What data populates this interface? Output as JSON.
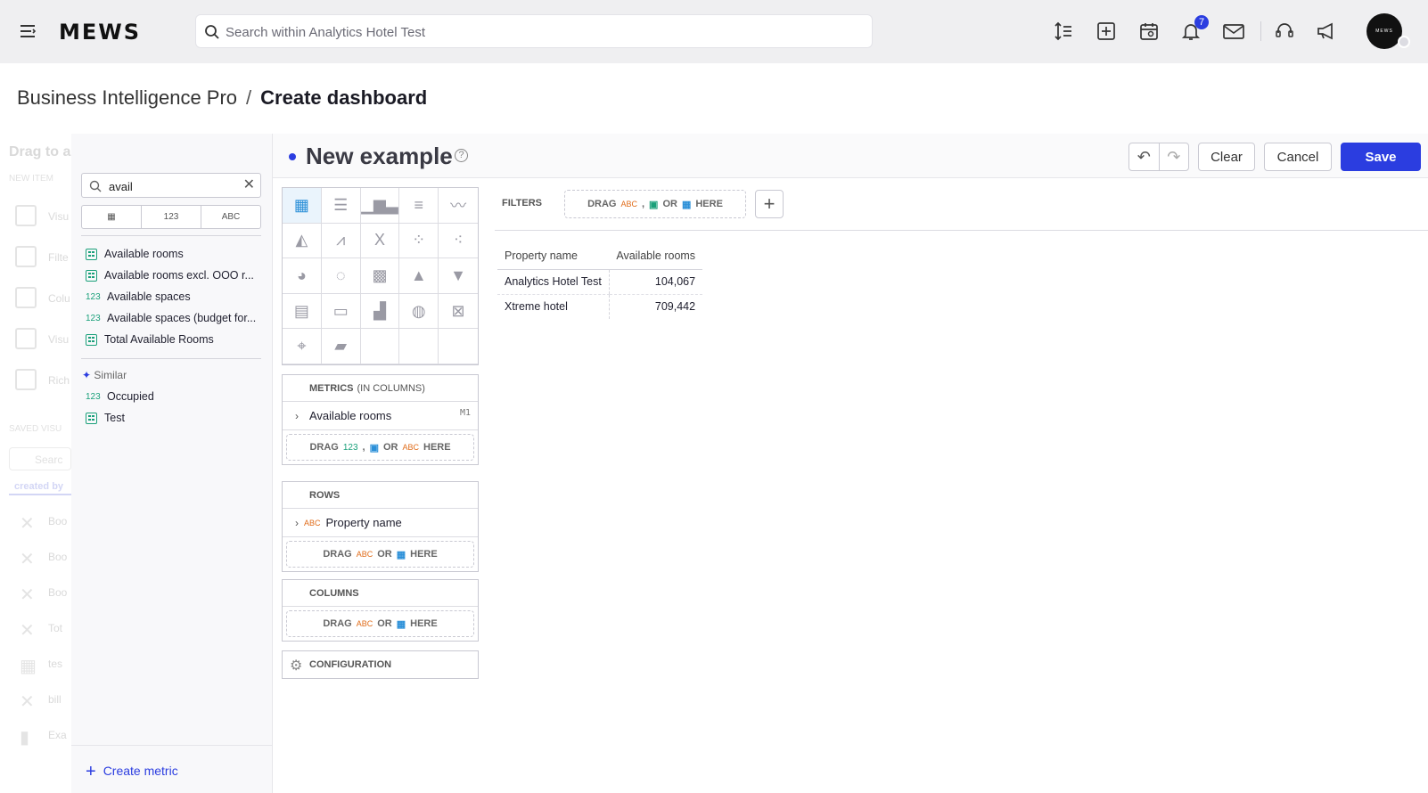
{
  "header": {
    "logo": "MEWS",
    "search_placeholder": "Search within Analytics Hotel Test",
    "notification_count": "7",
    "avatar_text": "MEWS"
  },
  "breadcrumb": {
    "parent": "Business Intelligence Pro",
    "separator": "/",
    "current": "Create dashboard"
  },
  "background_panel": {
    "title": "Drag to a",
    "new_item": "NEW ITEM",
    "items": [
      "Visu",
      "Filte",
      "Colu",
      "Visu",
      "Rich"
    ],
    "saved_label": "SAVED VISU",
    "search_placeholder": "Searc",
    "created_by": "created by",
    "saved_items": [
      "Boo",
      "Boo",
      "Boo",
      "Tot",
      "tes",
      "bill",
      "Exa"
    ]
  },
  "catalog": {
    "search_value": "avail",
    "type_filters": [
      "▦",
      "123",
      "ABC"
    ],
    "results": [
      {
        "kind": "attribute",
        "label": "Available rooms"
      },
      {
        "kind": "attribute",
        "label": "Available rooms excl. OOO r..."
      },
      {
        "kind": "fact",
        "label": "Available spaces"
      },
      {
        "kind": "fact",
        "label": "Available spaces (budget for..."
      },
      {
        "kind": "attribute",
        "label": "Total Available Rooms"
      }
    ],
    "similar_label": "Similar",
    "similar": [
      {
        "kind": "fact",
        "label": "Occupied"
      },
      {
        "kind": "attribute",
        "label": "Test"
      }
    ],
    "fact_marker": "123",
    "create_metric": "Create metric"
  },
  "editor": {
    "title": "New example",
    "help": "?",
    "buttons": {
      "clear": "Clear",
      "cancel": "Cancel",
      "save": "Save"
    },
    "filters": {
      "label": "FILTERS",
      "drag": "DRAG",
      "or": "OR",
      "here": "HERE",
      "abc": "ABC",
      "sep": ","
    },
    "metrics": {
      "label": "METRICS",
      "sub": "(IN COLUMNS)",
      "item": "Available rooms",
      "tag": "M1",
      "drag": "DRAG",
      "n123": "123",
      "sep": ",",
      "or": "OR",
      "abc": "ABC",
      "here": "HERE"
    },
    "rows": {
      "label": "ROWS",
      "item": "Property name",
      "abc": "ABC",
      "drag": "DRAG",
      "or": "OR",
      "here": "HERE"
    },
    "columns": {
      "label": "COLUMNS",
      "drag": "DRAG",
      "abc": "ABC",
      "or": "OR",
      "here": "HERE"
    },
    "configuration": "CONFIGURATION"
  },
  "table": {
    "headers": [
      "Property name",
      "Available rooms"
    ],
    "rows": [
      [
        "Analytics Hotel Test",
        "104,067"
      ],
      [
        "Xtreme hotel",
        "709,442"
      ]
    ]
  },
  "colors": {
    "accent": "#2b3de0",
    "fact": "#1aa07a",
    "attribute_abc": "#e06c1a",
    "date": "#2a8fd8"
  }
}
